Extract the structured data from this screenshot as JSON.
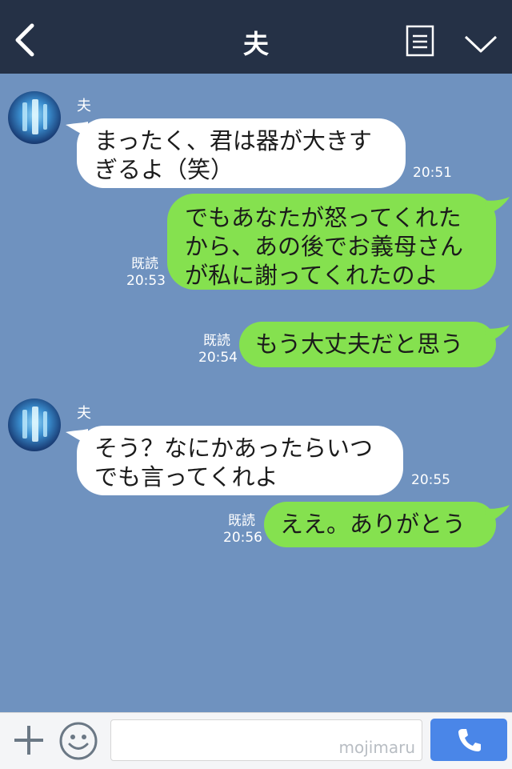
{
  "header": {
    "title": "夫"
  },
  "messages": [
    {
      "sender": "夫",
      "lines": [
        "まったく、君は器が大きす",
        "ぎるよ（笑）"
      ],
      "time": "20:51"
    },
    {
      "lines": [
        "でもあなたが怒ってくれた",
        "から、あの後でお義母さん",
        "が私に謝ってくれたのよ"
      ],
      "read": "既読",
      "time": "20:53"
    },
    {
      "lines": [
        "もう大丈夫だと思う"
      ],
      "read": "既読",
      "time": "20:54"
    },
    {
      "sender": "夫",
      "lines": [
        "そう？なにかあったらいつ",
        "でも言ってくれよ"
      ],
      "time": "20:55"
    },
    {
      "lines": [
        "ええ。ありがとう"
      ],
      "read": "既読",
      "time": "20:56"
    }
  ],
  "footer": {
    "watermark": "mojimaru"
  },
  "colors": {
    "header_bg": "#253146",
    "chat_bg": "#6f92bf",
    "outgoing_bubble": "#85e14f",
    "incoming_bubble": "#ffffff",
    "call_button": "#4a86e8"
  },
  "icons": {
    "back": "chevron-left-icon",
    "notes": "notes-icon",
    "menu": "chevron-down-icon",
    "add": "plus-icon",
    "emoji": "smiley-icon",
    "call": "phone-icon"
  }
}
